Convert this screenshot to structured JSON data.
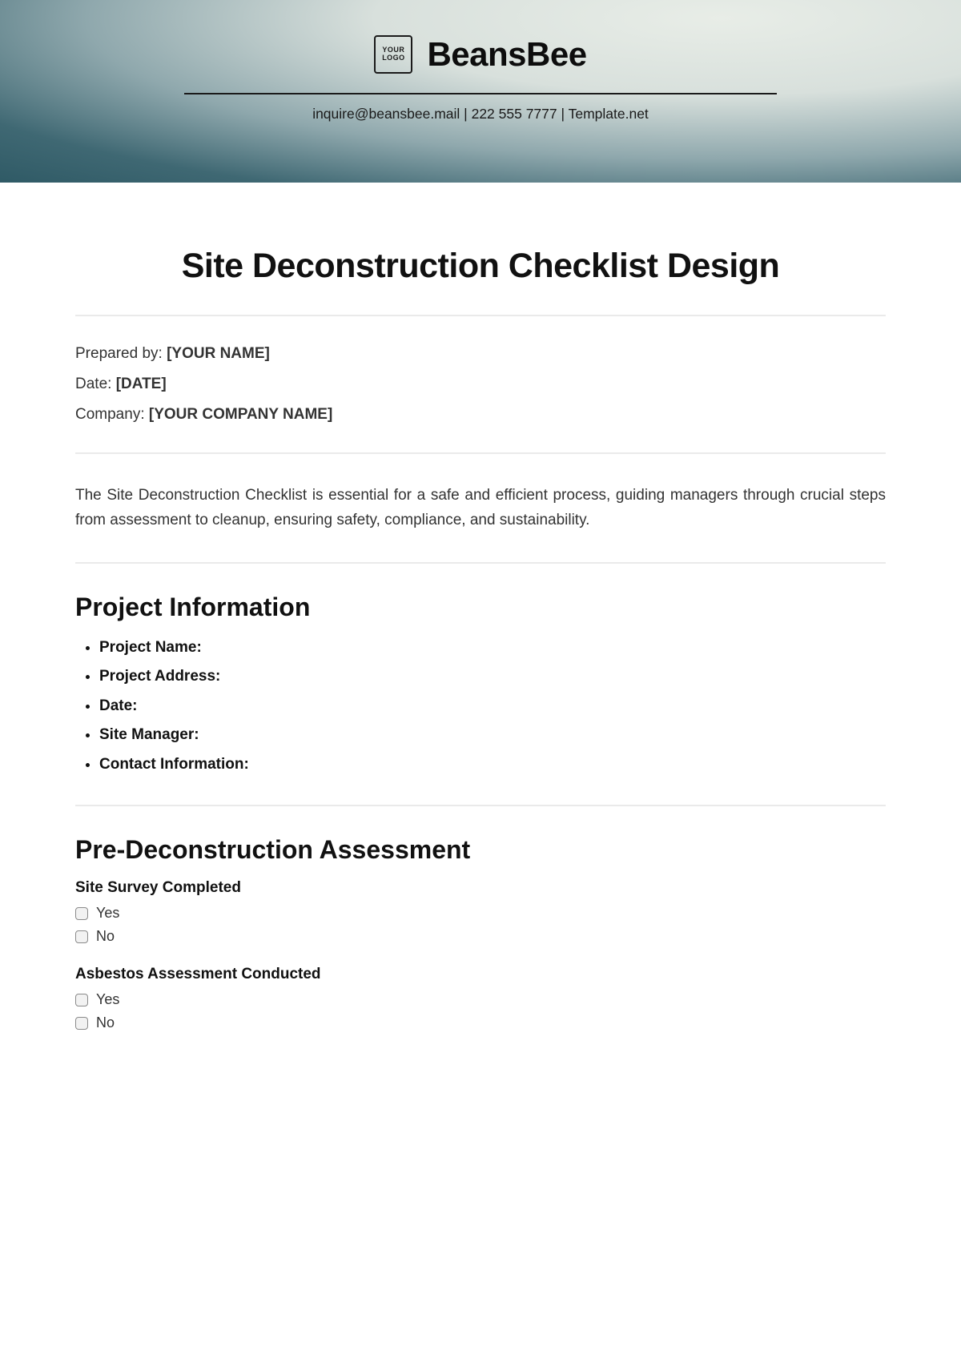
{
  "header": {
    "logo_line1": "YOUR",
    "logo_line2": "LOGO",
    "brand": "BeansBee",
    "contact": "inquire@beansbee.mail | 222 555 7777 | Template.net"
  },
  "doc_title": "Site Deconstruction Checklist Design",
  "meta": {
    "prepared_by_label": "Prepared by: ",
    "prepared_by_value": "[YOUR NAME]",
    "date_label": "Date: ",
    "date_value": "[DATE]",
    "company_label": "Company: ",
    "company_value": "[YOUR COMPANY NAME]"
  },
  "intro": "The Site Deconstruction Checklist is essential for a safe and efficient process, guiding managers through crucial steps from assessment to cleanup, ensuring safety, compliance, and sustainability.",
  "project_info": {
    "heading": "Project Information",
    "items": [
      "Project Name:",
      "Project Address:",
      "Date:",
      "Site Manager:",
      "Contact Information:"
    ]
  },
  "pre_assess": {
    "heading": "Pre-Deconstruction Assessment",
    "groups": [
      {
        "title": "Site Survey Completed",
        "options": [
          "Yes",
          "No"
        ]
      },
      {
        "title": "Asbestos Assessment Conducted",
        "options": [
          "Yes",
          "No"
        ]
      }
    ]
  }
}
